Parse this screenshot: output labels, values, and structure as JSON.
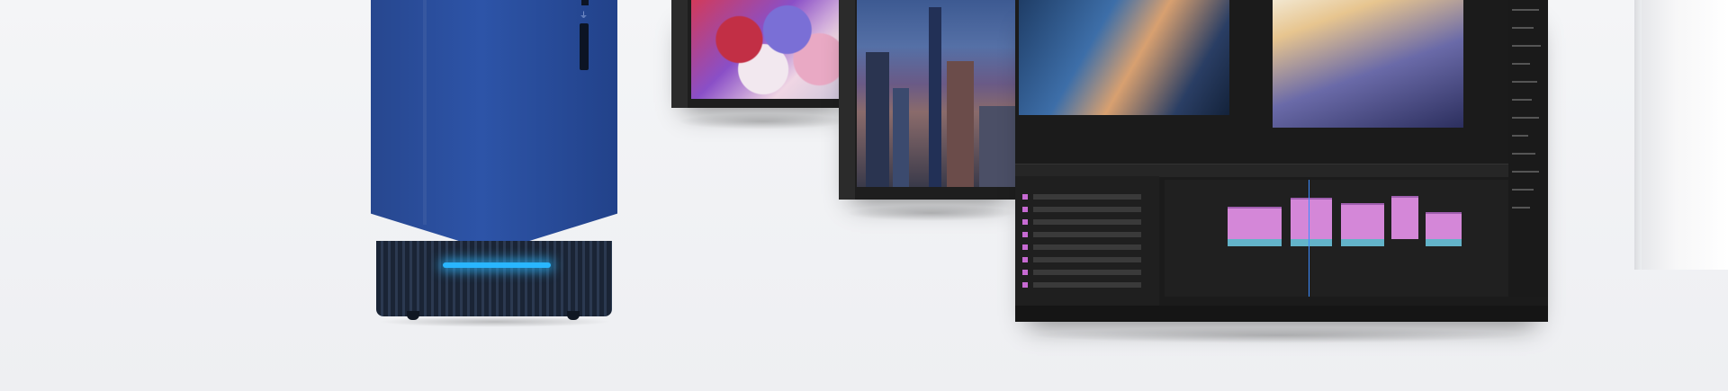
{
  "scene": {
    "background_color": "#f2f3f5",
    "tower": {
      "body_color": "#2d54a8",
      "glow_color": "#29b6ff",
      "icon": "usb-icon"
    },
    "screens": [
      {
        "id": "photo-editor",
        "icon": "brush-icon"
      },
      {
        "id": "image-editor-city",
        "icon": "image-icon"
      },
      {
        "id": "video-editor",
        "icon": "film-icon"
      }
    ]
  }
}
